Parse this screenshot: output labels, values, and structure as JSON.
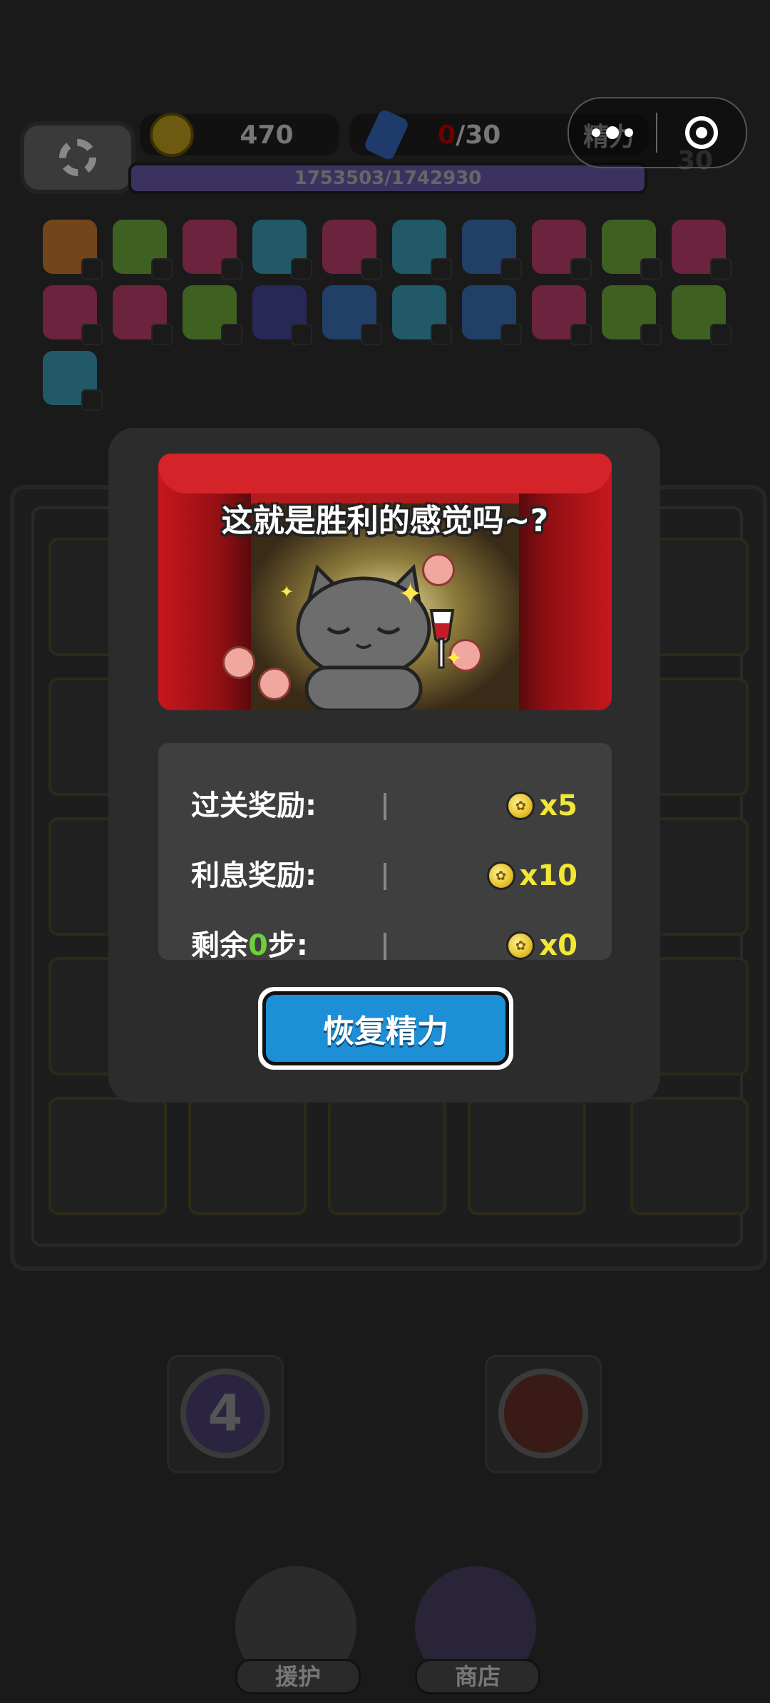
{
  "hud": {
    "coins": "470",
    "energy_current": "0",
    "energy_max": "/30",
    "energy_label": "精力",
    "xp_text": "1753503/1742930",
    "xp_progress": 1.0,
    "level": "30"
  },
  "capsule": {
    "more_icon": "more-dots-icon",
    "close_icon": "target-close-icon"
  },
  "board": {
    "bottom_tools": [
      {
        "label": "4"
      }
    ],
    "nav": [
      {
        "label": "援护"
      },
      {
        "label": "商店"
      }
    ]
  },
  "dialog": {
    "title": "这就是胜利的感觉吗~?",
    "rewards": [
      {
        "label": "过关奖励:",
        "amount": "x5"
      },
      {
        "label": "利息奖励:",
        "amount": "x10"
      },
      {
        "label_prefix": "剩余",
        "label_highlight": "0",
        "label_suffix": "步:",
        "amount": "x0"
      }
    ],
    "button_label": "恢复精力"
  },
  "colors": {
    "button_blue": "#1c8fd6",
    "amount_yellow": "#f2e637",
    "highlight_green": "#6fcf3a",
    "curtain_red": "#b51a1e"
  }
}
